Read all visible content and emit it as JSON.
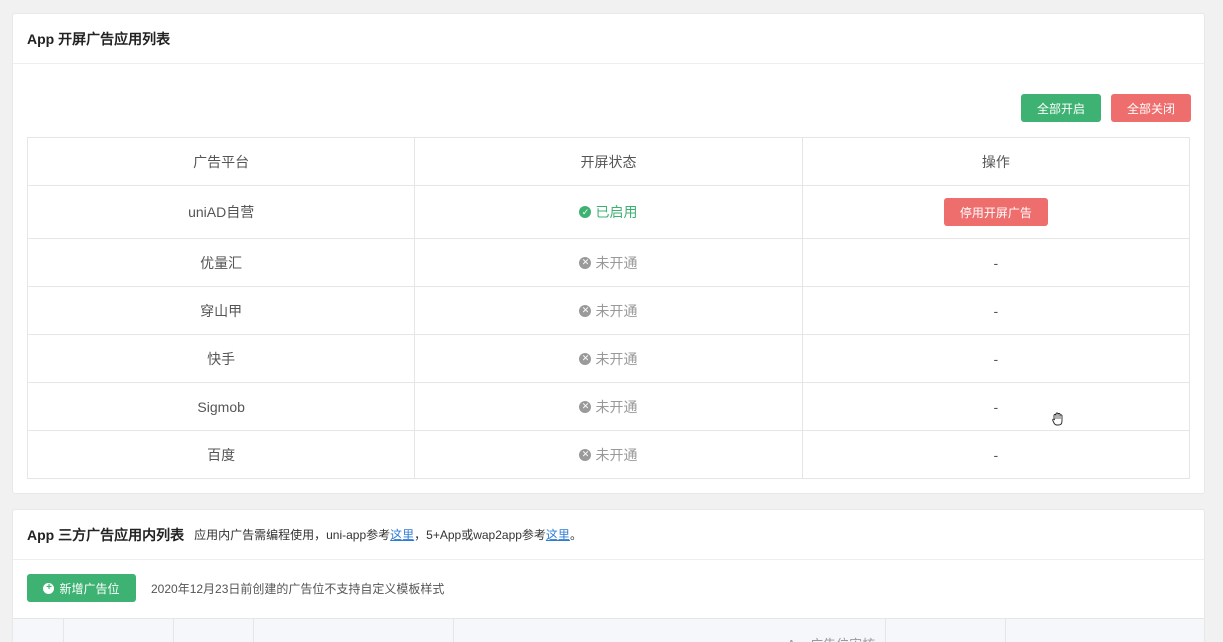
{
  "splash_card": {
    "title": "App 开屏广告应用列表",
    "enable_all_label": "全部开启",
    "disable_all_label": "全部关闭",
    "columns": [
      "广告平台",
      "开屏状态",
      "操作"
    ],
    "rows": [
      {
        "platform": "uniAD自营",
        "status": "已启用",
        "status_icon": "check-circle-icon",
        "action": "停用开屏广告"
      },
      {
        "platform": "优量汇",
        "status": "未开通",
        "status_icon": "x-circle-icon",
        "action": "-"
      },
      {
        "platform": "穿山甲",
        "status": "未开通",
        "status_icon": "x-circle-icon",
        "action": "-"
      },
      {
        "platform": "快手",
        "status": "未开通",
        "status_icon": "x-circle-icon",
        "action": "-"
      },
      {
        "platform": "Sigmob",
        "status": "未开通",
        "status_icon": "x-circle-icon",
        "action": "-"
      },
      {
        "platform": "百度",
        "status": "未开通",
        "status_icon": "x-circle-icon",
        "action": "-"
      }
    ]
  },
  "third_party_card": {
    "title": "App 三方广告应用内列表",
    "note_prefix": "应用内广告需编程使用，uni-app参考",
    "link1": "这里",
    "note_middle": "，5+App或wap2app参考",
    "link2": "这里",
    "note_suffix": "。",
    "add_button_label": "新增广告位",
    "toolbar_note": "2020年12月23日前创建的广告位不支持自定义模板样式",
    "partial_header": "App广告位审核"
  },
  "colors": {
    "green": "#3db272",
    "red": "#ee6d6d",
    "link": "#2e7cd6"
  }
}
